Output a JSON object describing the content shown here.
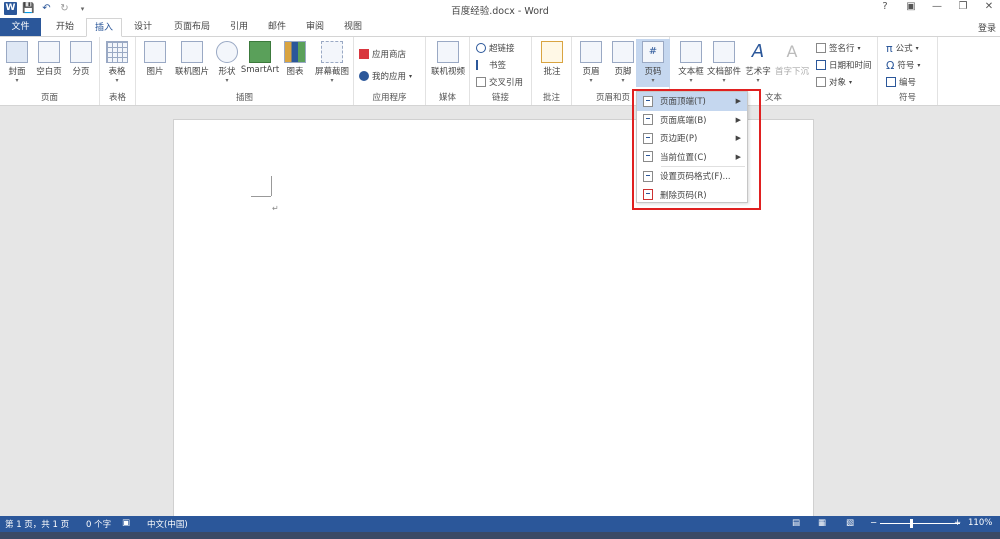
{
  "window": {
    "title": "百度经验.docx - Word",
    "controls": [
      "?",
      "▣",
      "—",
      "❐",
      "✕"
    ],
    "login": "登录",
    "app_icon": "W"
  },
  "tabs": [
    "文件",
    "开始",
    "插入",
    "设计",
    "页面布局",
    "引用",
    "邮件",
    "审阅",
    "视图"
  ],
  "ribbon": {
    "groups": {
      "pages": {
        "label": "页面",
        "buttons": [
          "封面",
          "空白页",
          "分页"
        ]
      },
      "tables": {
        "label": "表格",
        "buttons": [
          "表格"
        ]
      },
      "illustrations": {
        "label": "插图",
        "buttons": [
          "图片",
          "联机图片",
          "形状",
          "SmartArt",
          "图表",
          "屏幕截图"
        ]
      },
      "apps": {
        "label": "应用程序",
        "buttons": [
          "应用商店",
          "我的应用"
        ]
      },
      "media": {
        "label": "媒体",
        "buttons": [
          "联机视频"
        ]
      },
      "links": {
        "label": "链接",
        "buttons": [
          "超链接",
          "书签",
          "交叉引用"
        ]
      },
      "comments": {
        "label": "批注",
        "buttons": [
          "批注"
        ]
      },
      "header_footer": {
        "label": "页眉和页",
        "buttons": [
          "页眉",
          "页脚",
          "页码"
        ]
      },
      "text": {
        "label": "文本",
        "buttons": [
          "文本框",
          "文档部件",
          "艺术字",
          "首字下沉",
          "签名行",
          "日期和时间",
          "对象"
        ]
      },
      "symbols": {
        "label": "符号",
        "buttons": [
          "公式",
          "符号",
          "编号"
        ]
      }
    }
  },
  "menu": {
    "items": [
      {
        "label": "页面顶端(T)",
        "submenu": true
      },
      {
        "label": "页面底端(B)",
        "submenu": true
      },
      {
        "label": "页边距(P)",
        "submenu": true
      },
      {
        "label": "当前位置(C)",
        "submenu": true
      },
      {
        "label": "设置页码格式(F)...",
        "submenu": false
      },
      {
        "label": "删除页码(R)",
        "submenu": false
      }
    ]
  },
  "status": {
    "page": "第 1 页，共 1 页",
    "words": "0 个字",
    "language": "中文(中国)",
    "zoom": "110%"
  },
  "colors": {
    "accent": "#2b579a",
    "highlight": "#e02020"
  }
}
